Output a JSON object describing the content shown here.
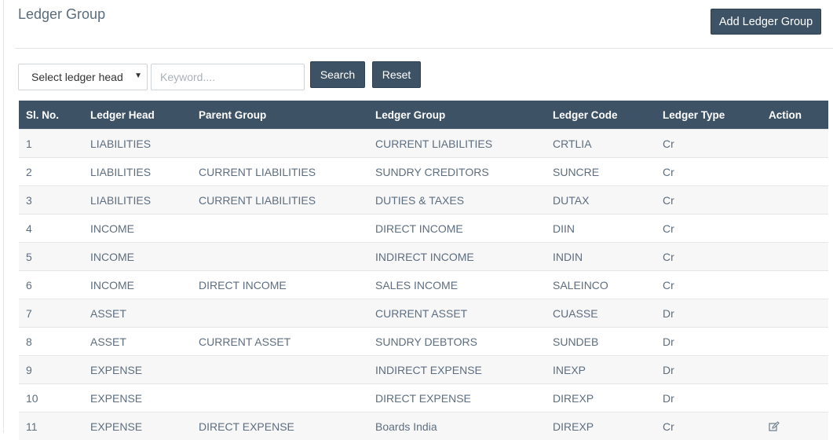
{
  "page": {
    "title": "Ledger Group",
    "add_button": "Add Ledger Group"
  },
  "filters": {
    "select_label": "Select ledger head",
    "keyword_placeholder": "Keyword....",
    "search_label": "Search",
    "reset_label": "Reset"
  },
  "table": {
    "headers": [
      "Sl. No.",
      "Ledger Head",
      "Parent Group",
      "Ledger Group",
      "Ledger Code",
      "Ledger Type",
      "Action"
    ],
    "rows": [
      {
        "sl": "1",
        "head": "LIABILITIES",
        "parent": "",
        "group": "CURRENT LIABILITIES",
        "code": "CRTLIA",
        "type": "Cr",
        "action": ""
      },
      {
        "sl": "2",
        "head": "LIABILITIES",
        "parent": "CURRENT LIABILITIES",
        "group": "SUNDRY CREDITORS",
        "code": "SUNCRE",
        "type": "Cr",
        "action": ""
      },
      {
        "sl": "3",
        "head": "LIABILITIES",
        "parent": "CURRENT LIABILITIES",
        "group": "DUTIES & TAXES",
        "code": "DUTAX",
        "type": "Cr",
        "action": ""
      },
      {
        "sl": "4",
        "head": "INCOME",
        "parent": "",
        "group": "DIRECT INCOME",
        "code": "DIIN",
        "type": "Cr",
        "action": ""
      },
      {
        "sl": "5",
        "head": "INCOME",
        "parent": "",
        "group": "INDIRECT INCOME",
        "code": "INDIN",
        "type": "Cr",
        "action": ""
      },
      {
        "sl": "6",
        "head": "INCOME",
        "parent": "DIRECT INCOME",
        "group": "SALES INCOME",
        "code": "SALEINCO",
        "type": "Cr",
        "action": ""
      },
      {
        "sl": "7",
        "head": "ASSET",
        "parent": "",
        "group": "CURRENT ASSET",
        "code": "CUASSE",
        "type": "Dr",
        "action": ""
      },
      {
        "sl": "8",
        "head": "ASSET",
        "parent": "CURRENT ASSET",
        "group": "SUNDRY DEBTORS",
        "code": "SUNDEB",
        "type": "Dr",
        "action": ""
      },
      {
        "sl": "9",
        "head": "EXPENSE",
        "parent": "",
        "group": "INDIRECT EXPENSE",
        "code": "INEXP",
        "type": "Dr",
        "action": ""
      },
      {
        "sl": "10",
        "head": "EXPENSE",
        "parent": "",
        "group": "DIRECT EXPENSE",
        "code": "DIREXP",
        "type": "Dr",
        "action": ""
      },
      {
        "sl": "11",
        "head": "EXPENSE",
        "parent": "DIRECT EXPENSE",
        "group": "Boards India",
        "code": "DIREXP",
        "type": "Cr",
        "action": "edit-icon"
      }
    ]
  },
  "colors": {
    "header_bg": "#3e5266",
    "button_bg": "#3e5266",
    "text": "#5e6e7f"
  }
}
